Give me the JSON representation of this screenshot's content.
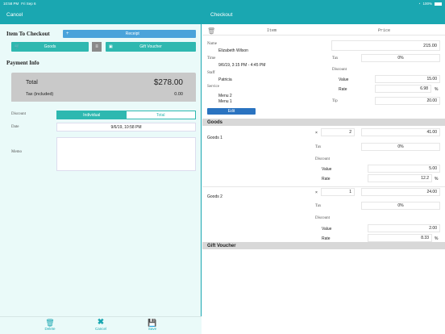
{
  "status": {
    "time": "10:58 PM",
    "date": "Fri Sep 6",
    "battery": "100%"
  },
  "nav": {
    "cancel": "Cancel",
    "title": "Checkout"
  },
  "left": {
    "item_to_checkout": "Item To Checkout",
    "receipt": "Receipt",
    "goods": "Goods",
    "gift_voucher": "Gift Voucher",
    "payment_info": "Payment Info",
    "total_label": "Total",
    "total_value": "$278.00",
    "tax_label": "Tax (included)",
    "tax_value": "0.00",
    "discount_label": "Discount",
    "seg_individual": "Individual",
    "seg_total": "Total",
    "date_label": "Date",
    "date_value": "9/6/19, 10:58 PM",
    "memo_label": "Memo",
    "toolbar": {
      "delete": "Delete",
      "cancel": "Cancel",
      "save": "Save"
    }
  },
  "right": {
    "col_item": "Item",
    "col_price": "Price",
    "name_label": "Name",
    "name_value": "Elizabeth Wilson",
    "time_label": "Time",
    "time_value": "9/6/19, 3:15 PM - 4:45 PM",
    "staff_label": "Staff",
    "staff_value": "Patricia",
    "service_label": "Service",
    "service_values": [
      "Menu 2",
      "Menu 1"
    ],
    "edit": "Edit",
    "price_value": "215.00",
    "tax_label": "Tax",
    "tax_value": "0%",
    "discount_label": "Discount",
    "value_label": "Value",
    "discount_value": "15.00",
    "rate_label": "Rate",
    "rate_value": "6.98",
    "pct": "%",
    "tip_label": "Tip",
    "tip_value": "20.00",
    "goods_header": "Goods",
    "goods": [
      {
        "name": "Goods 1",
        "mult": "×",
        "qty": "2",
        "price": "41.00",
        "tax": "0%",
        "value": "5.00",
        "rate": "12.2"
      },
      {
        "name": "Goods 2",
        "mult": "×",
        "qty": "1",
        "price": "24.00",
        "tax": "0%",
        "value": "2.00",
        "rate": "8.33"
      }
    ],
    "gift_header": "Gift Voucher"
  },
  "colors": {
    "accent": "#1aa7b1",
    "button": "#2eb8b0",
    "blue": "#4aa3da"
  }
}
